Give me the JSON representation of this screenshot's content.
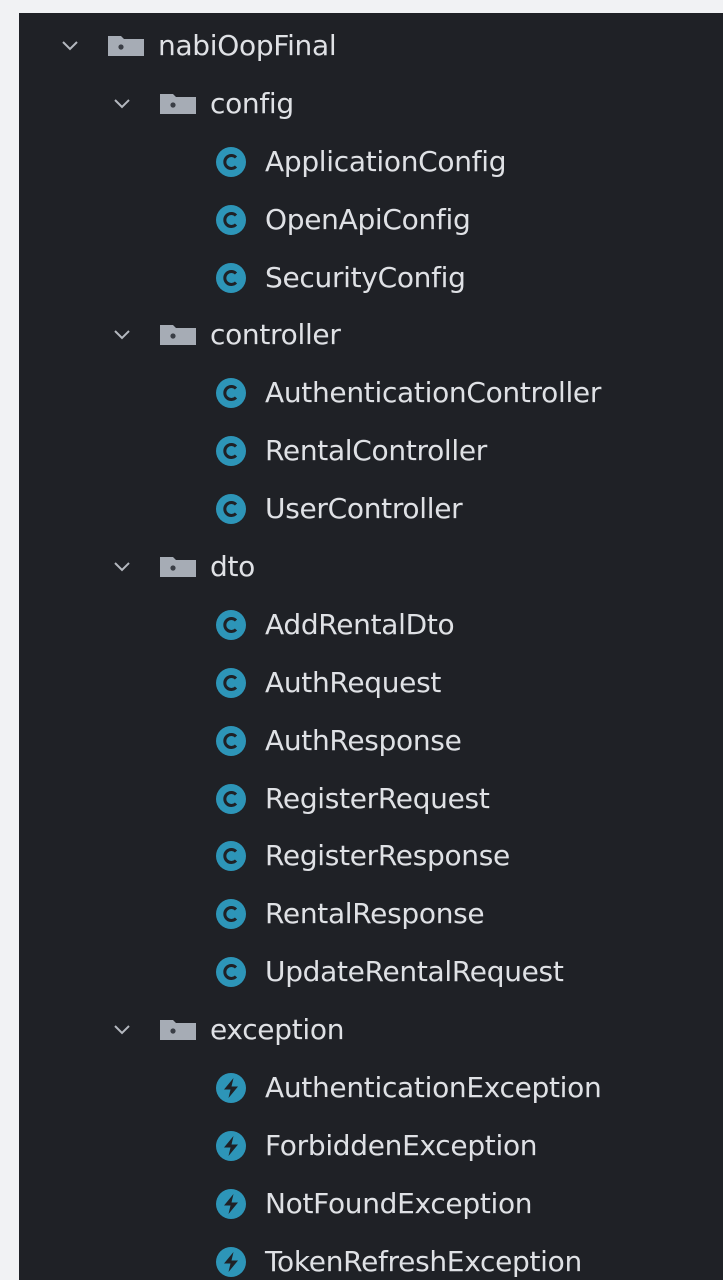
{
  "project_tree": {
    "root": {
      "label": "nabiOopFinal",
      "expanded": true,
      "packages": [
        {
          "label": "config",
          "expanded": true,
          "files": [
            {
              "label": "ApplicationConfig",
              "kind": "class",
              "icon": "class-icon"
            },
            {
              "label": "OpenApiConfig",
              "kind": "class",
              "icon": "class-icon"
            },
            {
              "label": "SecurityConfig",
              "kind": "class",
              "icon": "class-icon"
            }
          ]
        },
        {
          "label": "controller",
          "expanded": true,
          "files": [
            {
              "label": "AuthenticationController",
              "kind": "class",
              "icon": "class-icon"
            },
            {
              "label": "RentalController",
              "kind": "class",
              "icon": "class-icon"
            },
            {
              "label": "UserController",
              "kind": "class",
              "icon": "class-icon"
            }
          ]
        },
        {
          "label": "dto",
          "expanded": true,
          "files": [
            {
              "label": "AddRentalDto",
              "kind": "class",
              "icon": "class-icon"
            },
            {
              "label": "AuthRequest",
              "kind": "class",
              "icon": "class-icon"
            },
            {
              "label": "AuthResponse",
              "kind": "class",
              "icon": "class-icon"
            },
            {
              "label": "RegisterRequest",
              "kind": "class",
              "icon": "class-icon"
            },
            {
              "label": "RegisterResponse",
              "kind": "class",
              "icon": "class-icon"
            },
            {
              "label": "RentalResponse",
              "kind": "class",
              "icon": "class-icon"
            },
            {
              "label": "UpdateRentalRequest",
              "kind": "class",
              "icon": "class-icon"
            }
          ]
        },
        {
          "label": "exception",
          "expanded": true,
          "files": [
            {
              "label": "AuthenticationException",
              "kind": "exception",
              "icon": "exception-icon"
            },
            {
              "label": "ForbiddenException",
              "kind": "exception",
              "icon": "exception-icon"
            },
            {
              "label": "NotFoundException",
              "kind": "exception",
              "icon": "exception-icon"
            },
            {
              "label": "TokenRefreshException",
              "kind": "exception",
              "icon": "exception-icon"
            }
          ]
        }
      ]
    }
  },
  "colors": {
    "page_background": "#f1f2f4",
    "panel_background": "#1f2126",
    "text": "#dfe1e5",
    "chevron": "#b4b8bf",
    "folder": "#a6acb5",
    "folder_dot": "#3a3e46",
    "class_icon": "#2d95b8",
    "class_glyph": "#1f2126",
    "exception_icon": "#2d95b8"
  }
}
